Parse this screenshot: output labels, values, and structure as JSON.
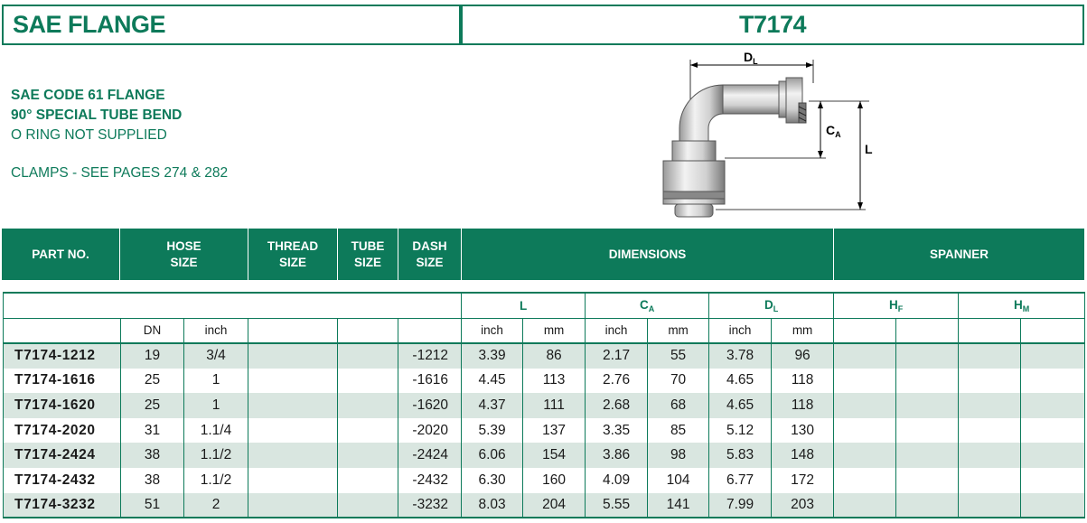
{
  "header": {
    "title_left": "SAE FLANGE",
    "title_right": "T7174"
  },
  "description": {
    "line1": "SAE CODE 61 FLANGE",
    "line2": "90° SPECIAL TUBE BEND",
    "line3": "O RING NOT SUPPLIED",
    "line4": "CLAMPS - SEE PAGES 274 & 282"
  },
  "diagram": {
    "dl_label": "D",
    "dl_sub": "L",
    "ca_label": "C",
    "ca_sub": "A",
    "l_label": "L"
  },
  "band": {
    "part_no": "PART NO.",
    "hose_size_1": "HOSE",
    "hose_size_2": "SIZE",
    "thread_size_1": "THREAD",
    "thread_size_2": "SIZE",
    "tube_size_1": "TUBE",
    "tube_size_2": "SIZE",
    "dash_size_1": "DASH",
    "dash_size_2": "SIZE",
    "dimensions": "DIMENSIONS",
    "spanner": "SPANNER"
  },
  "table": {
    "group_l": "L",
    "group_ca": "C",
    "group_ca_sub": "A",
    "group_dl": "D",
    "group_dl_sub": "L",
    "group_hf": "H",
    "group_hf_sub": "F",
    "group_hm": "H",
    "group_hm_sub": "M",
    "unit_dn": "DN",
    "unit_inch": "inch",
    "unit_mm": "mm",
    "rows": [
      {
        "part": "T7174-1212",
        "dn": "19",
        "inch": "3/4",
        "dash": "-1212",
        "l_in": "3.39",
        "l_mm": "86",
        "ca_in": "2.17",
        "ca_mm": "55",
        "dl_in": "3.78",
        "dl_mm": "96"
      },
      {
        "part": "T7174-1616",
        "dn": "25",
        "inch": "1",
        "dash": "-1616",
        "l_in": "4.45",
        "l_mm": "113",
        "ca_in": "2.76",
        "ca_mm": "70",
        "dl_in": "4.65",
        "dl_mm": "118"
      },
      {
        "part": "T7174-1620",
        "dn": "25",
        "inch": "1",
        "dash": "-1620",
        "l_in": "4.37",
        "l_mm": "111",
        "ca_in": "2.68",
        "ca_mm": "68",
        "dl_in": "4.65",
        "dl_mm": "118"
      },
      {
        "part": "T7174-2020",
        "dn": "31",
        "inch": "1.1/4",
        "dash": "-2020",
        "l_in": "5.39",
        "l_mm": "137",
        "ca_in": "3.35",
        "ca_mm": "85",
        "dl_in": "5.12",
        "dl_mm": "130"
      },
      {
        "part": "T7174-2424",
        "dn": "38",
        "inch": "1.1/2",
        "dash": "-2424",
        "l_in": "6.06",
        "l_mm": "154",
        "ca_in": "3.86",
        "ca_mm": "98",
        "dl_in": "5.83",
        "dl_mm": "148"
      },
      {
        "part": "T7174-2432",
        "dn": "38",
        "inch": "1.1/2",
        "dash": "-2432",
        "l_in": "6.30",
        "l_mm": "160",
        "ca_in": "4.09",
        "ca_mm": "104",
        "dl_in": "6.77",
        "dl_mm": "172"
      },
      {
        "part": "T7174-3232",
        "dn": "51",
        "inch": "2",
        "dash": "-3232",
        "l_in": "8.03",
        "l_mm": "204",
        "ca_in": "5.55",
        "ca_mm": "141",
        "dl_in": "7.99",
        "dl_mm": "203"
      }
    ]
  },
  "colors": {
    "brand_green": "#0d7a5a",
    "row_alt": "#d9e6e0"
  }
}
